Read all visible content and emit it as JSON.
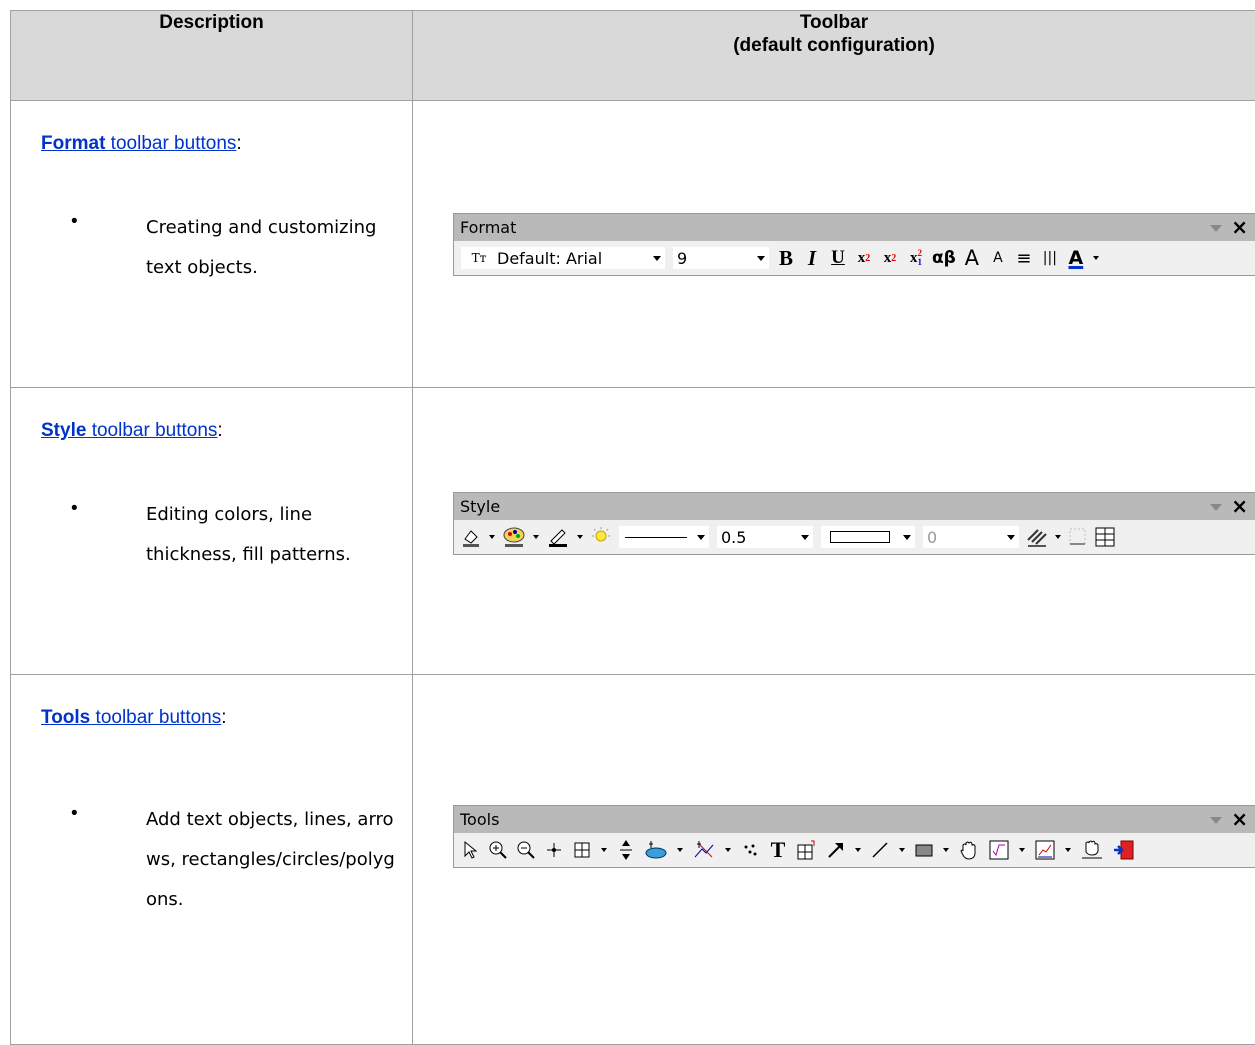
{
  "header": {
    "description": "Description",
    "toolbar_line1": "Toolbar",
    "toolbar_line2": "(default configuration)"
  },
  "rows": [
    {
      "link_bold": "Format",
      "link_rest": " toolbar buttons",
      "colon": ":",
      "bullet": "Creating and customizing text objects.",
      "toolbar": {
        "title": "Format",
        "close": "×",
        "font_value": "Default: Arial",
        "size_value": "9",
        "buttons": [
          "B",
          "I",
          "U",
          "x²",
          "x₂",
          "x²₁",
          "αβ",
          "A",
          "A",
          "≡",
          "|||",
          "A"
        ]
      }
    },
    {
      "link_bold": "Style",
      "link_rest": " toolbar buttons",
      "colon": ":",
      "bullet": "Editing colors, line thickness, fill patterns.",
      "toolbar": {
        "title": "Style",
        "close": "×",
        "line_width_value": "0.5",
        "transparency_value": "0"
      }
    },
    {
      "link_bold": "Tools",
      "link_rest": " toolbar buttons",
      "colon": ":",
      "bullet": "Add text objects, lines, arrows, rectangles/circles/polygons.",
      "toolbar": {
        "title": "Tools",
        "close": "×",
        "text_tool_label": "T"
      }
    }
  ]
}
